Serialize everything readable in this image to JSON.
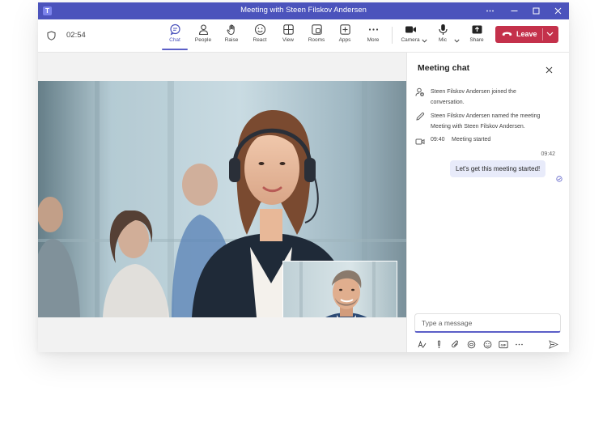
{
  "window": {
    "title": "Meeting with Steen Filskov Andersen",
    "controls": [
      "more-icon",
      "minimize-icon",
      "maximize-icon",
      "close-icon"
    ]
  },
  "toolbar": {
    "timer": "02:54",
    "items": [
      {
        "label": "Chat",
        "icon": "chat-icon",
        "active": true
      },
      {
        "label": "People",
        "icon": "people-icon"
      },
      {
        "label": "Raise",
        "icon": "hand-icon"
      },
      {
        "label": "React",
        "icon": "smiley-icon"
      },
      {
        "label": "View",
        "icon": "view-grid-icon"
      },
      {
        "label": "Rooms",
        "icon": "rooms-icon"
      },
      {
        "label": "Apps",
        "icon": "apps-icon"
      },
      {
        "label": "More",
        "icon": "more-icon"
      },
      {
        "label": "Camera",
        "icon": "camera-icon"
      },
      {
        "label": "Mic",
        "icon": "mic-icon"
      },
      {
        "label": "Share",
        "icon": "share-icon"
      }
    ],
    "leave_label": "Leave"
  },
  "chat": {
    "title": "Meeting chat",
    "events": [
      {
        "icon": "person-join-icon",
        "text": [
          "Steen Filskov Andersen joined the",
          "conversation."
        ]
      },
      {
        "icon": "pencil-icon",
        "text": [
          "Steen Filskov Andersen named the meeting",
          "Meeting with Steen Filskov Andersen."
        ]
      },
      {
        "icon": "video-icon",
        "time": "09:40",
        "text": "Meeting started"
      }
    ],
    "message": {
      "time": "09:42",
      "text": "Let's get this meeting started!"
    },
    "compose_placeholder": "Type a message",
    "compose_tools": [
      "format-icon",
      "important-icon",
      "attach-icon",
      "loop-icon",
      "emoji-icon",
      "gif-icon",
      "more-icon",
      "send-icon"
    ]
  },
  "colors": {
    "titlebar": "#4b53bc",
    "accent": "#5b5fc7",
    "leave": "#c4314b",
    "bubble": "#e8ebfa"
  }
}
